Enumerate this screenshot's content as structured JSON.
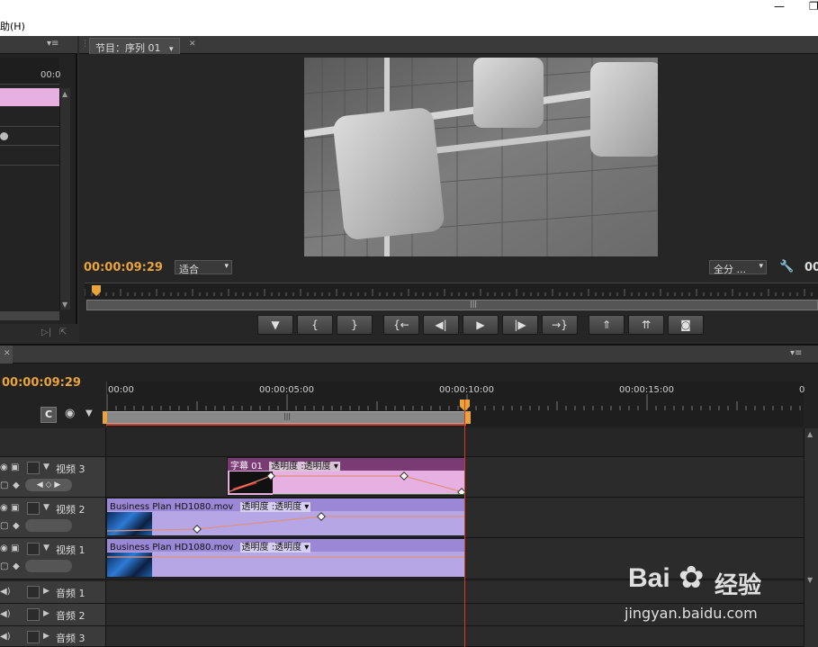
{
  "menubar": {
    "menu_fragment": "助(H)",
    "minimize": "—",
    "restore": "❐"
  },
  "left_panel": {
    "menu_icon": "▾≡",
    "ruler_tc": "00:0"
  },
  "program_monitor": {
    "tab_label": "节目：序列 01",
    "close_icon": "✕",
    "timecode": "00:00:09:29",
    "zoom_select": "适合",
    "quality_select": "全分 ...",
    "duration_fragment": "00",
    "controls": [
      {
        "name": "add-marker-button",
        "glyph": "▼"
      },
      {
        "name": "mark-in-button",
        "glyph": "{"
      },
      {
        "name": "mark-out-button",
        "glyph": "}"
      },
      {
        "name": "go-to-in-button",
        "glyph": "{←"
      },
      {
        "name": "step-back-button",
        "glyph": "◀|"
      },
      {
        "name": "play-button",
        "glyph": "▶"
      },
      {
        "name": "step-forward-button",
        "glyph": "|▶"
      },
      {
        "name": "go-to-out-button",
        "glyph": "→}"
      },
      {
        "name": "lift-button",
        "glyph": "⇑"
      },
      {
        "name": "extract-button",
        "glyph": "⇈"
      },
      {
        "name": "export-frame-button",
        "glyph": "◙"
      }
    ]
  },
  "timeline": {
    "close_icon": "✕",
    "timecode": "00:00:09:29",
    "ruler_labels": [
      "00:00",
      "00:00:05:00",
      "00:00:10:00",
      "00:00:15:00",
      "0"
    ],
    "tracks": [
      {
        "name": "视频 3",
        "type": "video"
      },
      {
        "name": "视频 2",
        "type": "video"
      },
      {
        "name": "视频 1",
        "type": "video"
      },
      {
        "name": "音频 1",
        "type": "audio"
      },
      {
        "name": "音频 2",
        "type": "audio"
      },
      {
        "name": "音频 3",
        "type": "audio"
      }
    ],
    "clips": {
      "title_clip": {
        "label": "字幕  01",
        "effect": "透明度 :透明度 ▾"
      },
      "v2_clip": {
        "label": "Business Plan HD1080.mov",
        "effect": "透明度 :透明度 ▾"
      },
      "v1_clip": {
        "label": "Business Plan HD1080.mov",
        "effect": "透明度 :透明度 ▾"
      }
    }
  },
  "watermark": {
    "brand": "Bai",
    "brand_suffix": "经验",
    "url": "jingyan.baidu.com"
  },
  "colors": {
    "timecode": "#e8a33a",
    "playhead": "#d23c2c",
    "title_clip": "#e7b0e3",
    "video_clip": "#b6a6e6"
  }
}
